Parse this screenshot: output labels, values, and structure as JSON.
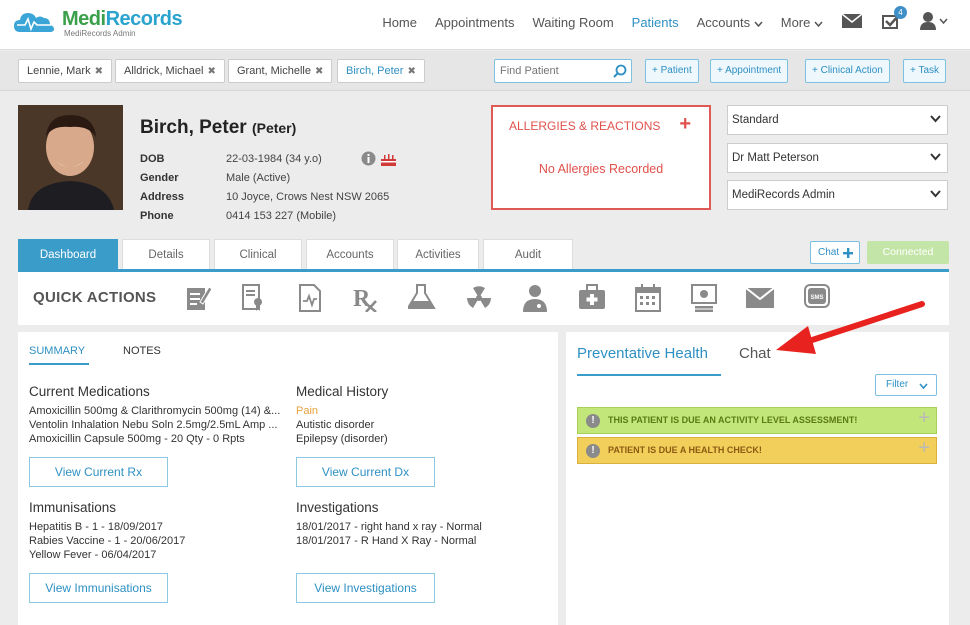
{
  "app": {
    "logo_title_left": "Medi",
    "logo_title_right": "Records",
    "logo_subtitle": "MediRecords Admin"
  },
  "nav": {
    "home": "Home",
    "appointments": "Appointments",
    "waiting_room": "Waiting Room",
    "patients": "Patients",
    "accounts": "Accounts",
    "more": "More",
    "tasks_count": "4"
  },
  "open_patients": [
    "Lennie, Mark",
    "Alldrick, Michael",
    "Grant, Michelle",
    "Birch, Peter"
  ],
  "find_patient": {
    "placeholder": "Find Patient"
  },
  "quick_add": {
    "patient": "+ Patient",
    "appointment": "+ Appointment",
    "clinical_action": "+ Clinical Action",
    "task": "+ Task"
  },
  "patient": {
    "name": "Birch, Peter",
    "nickname": "(Peter)",
    "dob_label": "DOB",
    "dob": "22-03-1984 (34 y.o)",
    "gender_label": "Gender",
    "gender": "Male (Active)",
    "address_label": "Address",
    "address": "10 Joyce, Crows Nest NSW 2065",
    "phone_label": "Phone",
    "phone": "0414 153 227 (Mobile)"
  },
  "allergies": {
    "title": "ALLERGIES & REACTIONS",
    "empty": "No Allergies Recorded"
  },
  "selectors": {
    "billing": "Standard",
    "doctor": "Dr Matt Peterson",
    "practice": "MediRecords Admin"
  },
  "tabs": {
    "dashboard": "Dashboard",
    "details": "Details",
    "clinical": "Clinical",
    "accounts": "Accounts",
    "activities": "Activities",
    "audit": "Audit"
  },
  "chat_button": "Chat",
  "connection_status": "Connected",
  "quick_actions": {
    "title": "QUICK ACTIONS"
  },
  "summary": {
    "tab_summary": "SUMMARY",
    "tab_notes": "NOTES",
    "medications_title": "Current Medications",
    "medications": [
      "Amoxicillin 500mg & Clarithromycin 500mg (14) &...",
      "Ventolin Inhalation Nebu Soln 2.5mg/2.5mL Amp ...",
      "Amoxicillin Capsule 500mg - 20 Qty - 0 Rpts"
    ],
    "view_rx": "View Current Rx",
    "history_title": "Medical History",
    "history": [
      "Pain",
      "Autistic disorder",
      "Epilepsy (disorder)"
    ],
    "view_dx": "View Current Dx",
    "immunisations_title": "Immunisations",
    "immunisations": [
      "Hepatitis B - 1 - 18/09/2017",
      "Rabies Vaccine - 1 - 20/06/2017",
      "Yellow Fever - 06/04/2017"
    ],
    "view_immunisations": "View Immunisations",
    "investigations_title": "Investigations",
    "investigations": [
      "18/01/2017 - right hand x ray - Normal",
      "18/01/2017 - R Hand X Ray - Normal"
    ],
    "view_investigations": "View Investigations"
  },
  "right_panel": {
    "tab_preventative": "Preventative Health",
    "tab_chat": "Chat",
    "filter": "Filter",
    "alerts": [
      "THIS PATIENT IS DUE AN ACTIVITY LEVEL ASSESSMENT!",
      "PATIENT IS DUE A HEALTH CHECK!"
    ]
  },
  "colors": {
    "brand_blue": "#2e90c3",
    "brand_green": "#3aa04a",
    "allergy_red": "#e0514c",
    "alert_green": "#c3e67a",
    "alert_yellow": "#f2cf5b",
    "annotation_arrow": "#e8231f"
  }
}
